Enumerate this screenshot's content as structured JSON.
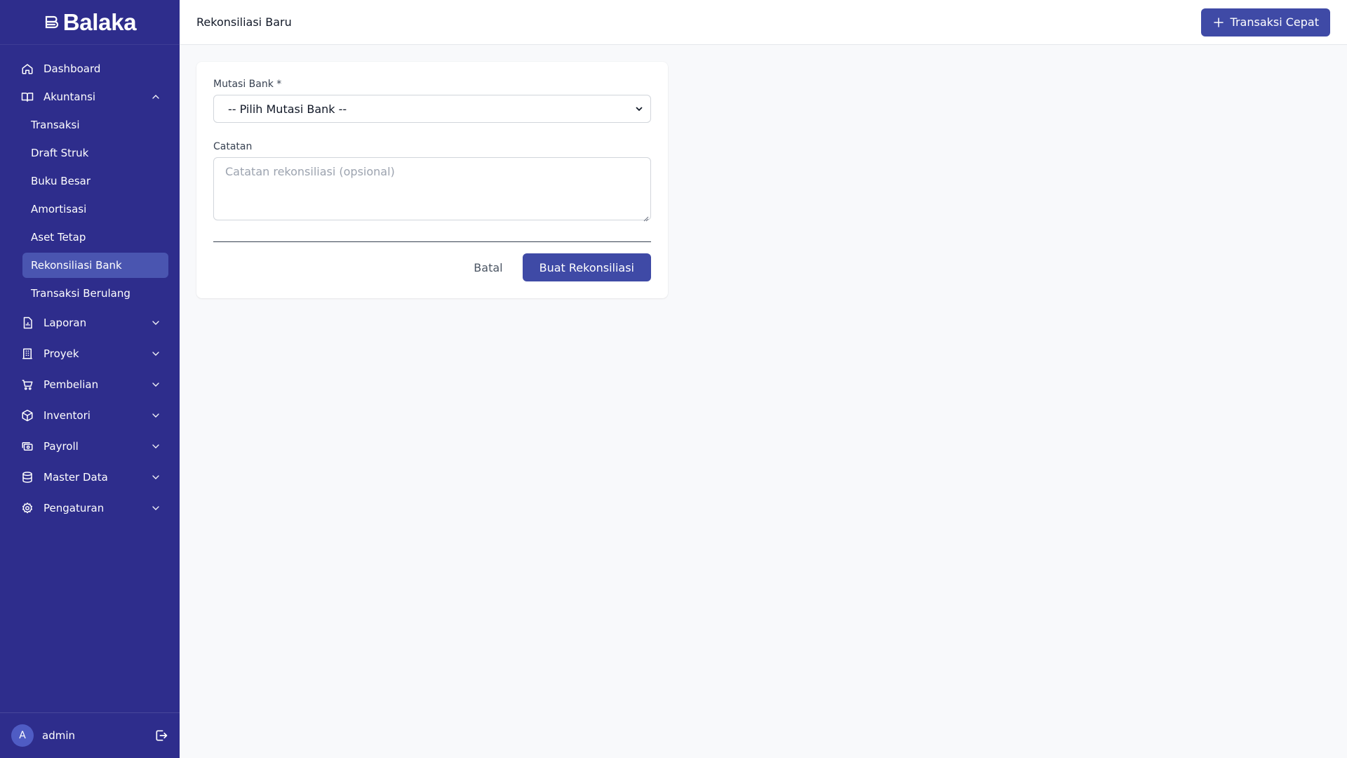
{
  "brand": {
    "name": "Balaka",
    "logo_icon": "stacked-lines-logo"
  },
  "colors": {
    "sidebar_bg": "#2e2d8c",
    "active_item": "#4a55b0",
    "primary": "#3f4aa6"
  },
  "sidebar": {
    "top_items": [
      {
        "label": "Dashboard",
        "icon": "home-icon"
      },
      {
        "label": "Akuntansi",
        "icon": "book-icon",
        "expanded": true
      }
    ],
    "akuntansi_sub": [
      {
        "label": "Transaksi",
        "active": false
      },
      {
        "label": "Draft Struk",
        "active": false
      },
      {
        "label": "Buku Besar",
        "active": false
      },
      {
        "label": "Amortisasi",
        "active": false
      },
      {
        "label": "Aset Tetap",
        "active": false
      },
      {
        "label": "Rekonsiliasi Bank",
        "active": true
      },
      {
        "label": "Transaksi Berulang",
        "active": false
      }
    ],
    "sections": [
      {
        "label": "Laporan",
        "icon": "report-icon"
      },
      {
        "label": "Proyek",
        "icon": "building-icon"
      },
      {
        "label": "Pembelian",
        "icon": "cart-icon"
      },
      {
        "label": "Inventori",
        "icon": "box-icon"
      },
      {
        "label": "Payroll",
        "icon": "money-icon"
      },
      {
        "label": "Master Data",
        "icon": "database-icon"
      },
      {
        "label": "Pengaturan",
        "icon": "gear-icon"
      }
    ],
    "user": {
      "initial": "A",
      "name": "admin"
    }
  },
  "header": {
    "title": "Rekonsiliasi Baru",
    "quick_button": "Transaksi Cepat"
  },
  "form": {
    "mutasi_label": "Mutasi Bank *",
    "mutasi_selected": "-- Pilih Mutasi Bank --",
    "catatan_label": "Catatan",
    "catatan_placeholder": "Catatan rekonsiliasi (opsional)",
    "cancel_label": "Batal",
    "submit_label": "Buat Rekonsiliasi"
  }
}
